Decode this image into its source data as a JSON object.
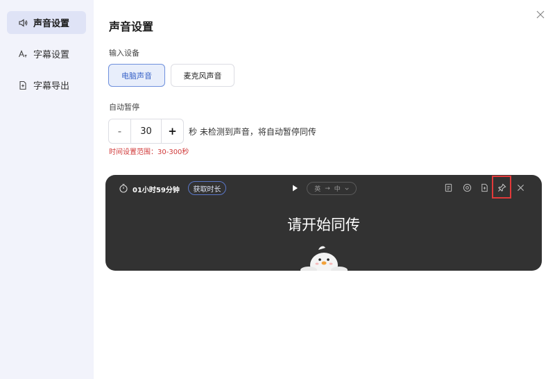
{
  "sidebar": {
    "items": [
      {
        "label": "声音设置",
        "icon": "speaker-icon",
        "active": true
      },
      {
        "label": "字幕设置",
        "icon": "font-size-icon",
        "active": false
      },
      {
        "label": "字幕导出",
        "icon": "file-export-icon",
        "active": false
      }
    ]
  },
  "page": {
    "title": "声音设置"
  },
  "input_device": {
    "label": "输入设备",
    "options": [
      "电脑声音",
      "麦克风声音"
    ],
    "selected": "电脑声音"
  },
  "auto_pause": {
    "label": "自动暂停",
    "minus": "-",
    "plus": "+",
    "value": "30",
    "description": "秒 未检测到声音，将自动暂停同传",
    "range_hint": "时间设置范围：30-300秒"
  },
  "preview": {
    "timer": "01小时59分钟",
    "get_time_button": "获取时长",
    "lang_from": "英",
    "lang_arrow": "→",
    "lang_to": "中",
    "caption": "请开始同传",
    "tool_icons": [
      "document-icon",
      "record-icon",
      "export-icon",
      "pin-icon",
      "close-icon"
    ]
  },
  "colors": {
    "accent": "#3a64c8",
    "preview_bg": "#323232",
    "highlight": "#e23a3a",
    "hint": "#d03a3a"
  }
}
